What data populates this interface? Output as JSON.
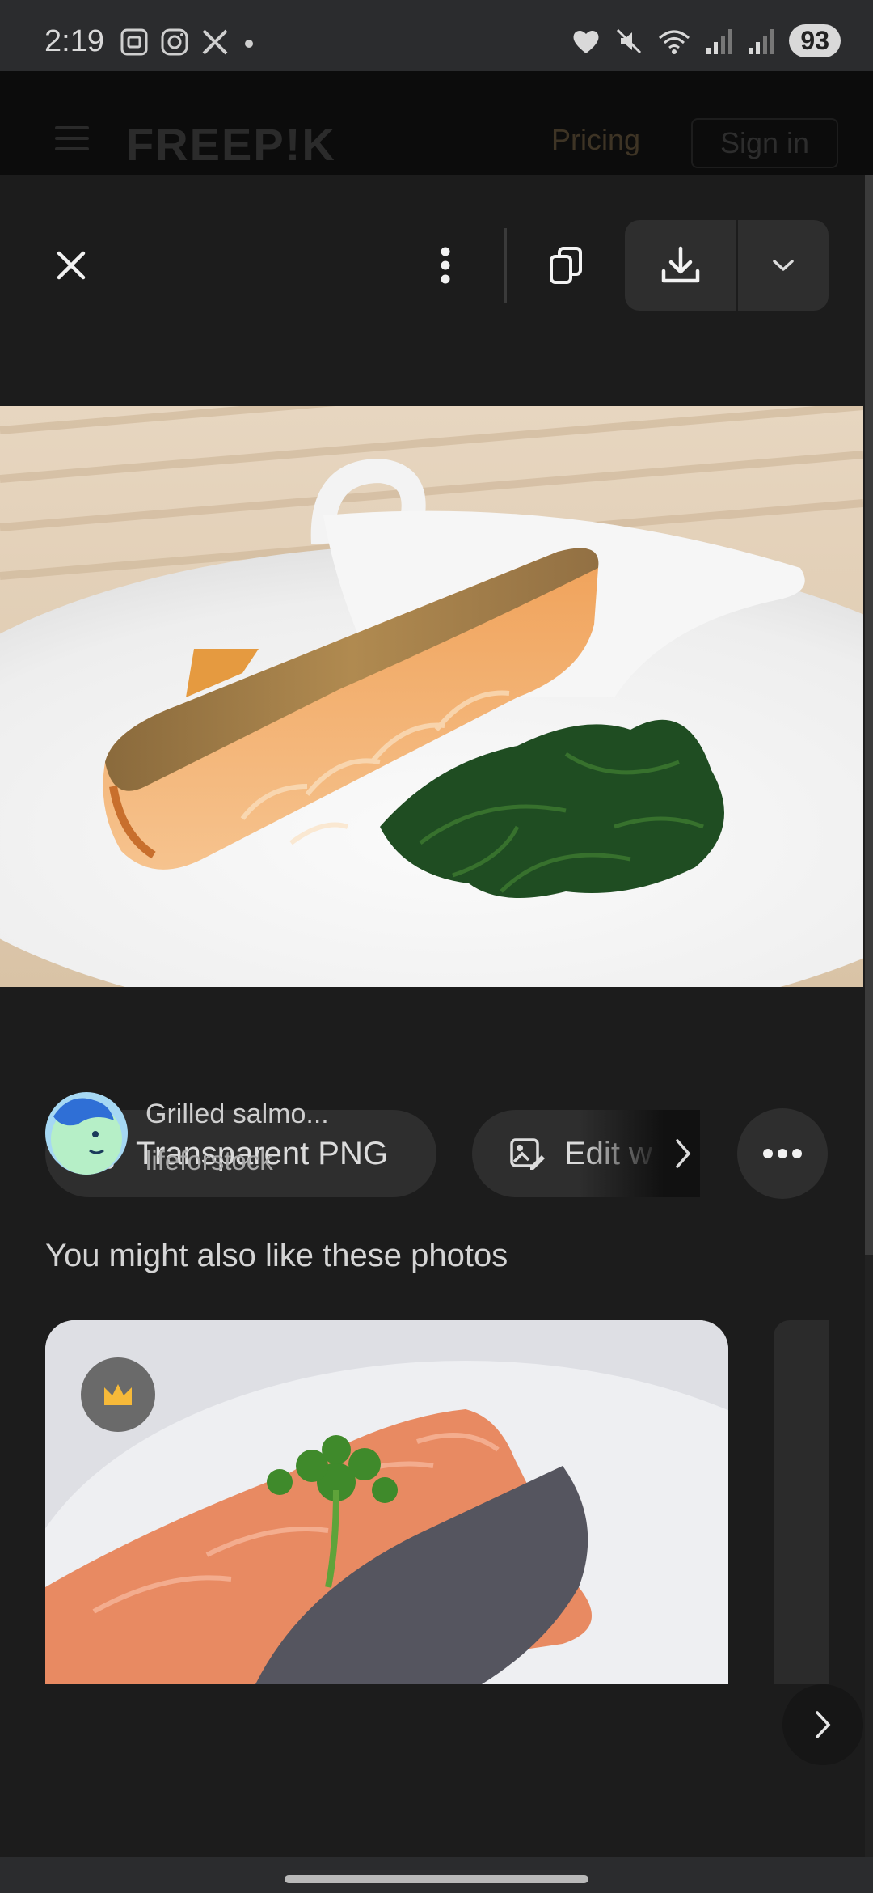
{
  "status_bar": {
    "time": "2:19",
    "battery": "93"
  },
  "site_header": {
    "logo": "FREEP!K",
    "pricing": "Pricing",
    "sign_in": "Sign in"
  },
  "toolbar": {
    "close_icon": "close-icon",
    "more_icon": "more-vertical-icon",
    "copy_icon": "copy-icon",
    "download_icon": "download-icon",
    "expand_icon": "chevron-down-icon"
  },
  "actions": {
    "transparent_png": "Transparent PNG",
    "edit_label": "Edit w"
  },
  "asset": {
    "title": "Grilled salmo...",
    "author": "lifeforstock"
  },
  "related": {
    "heading": "You might also like these photos"
  },
  "colors": {
    "background": "#1c1c1c",
    "premium_crown": "#f6b939"
  }
}
